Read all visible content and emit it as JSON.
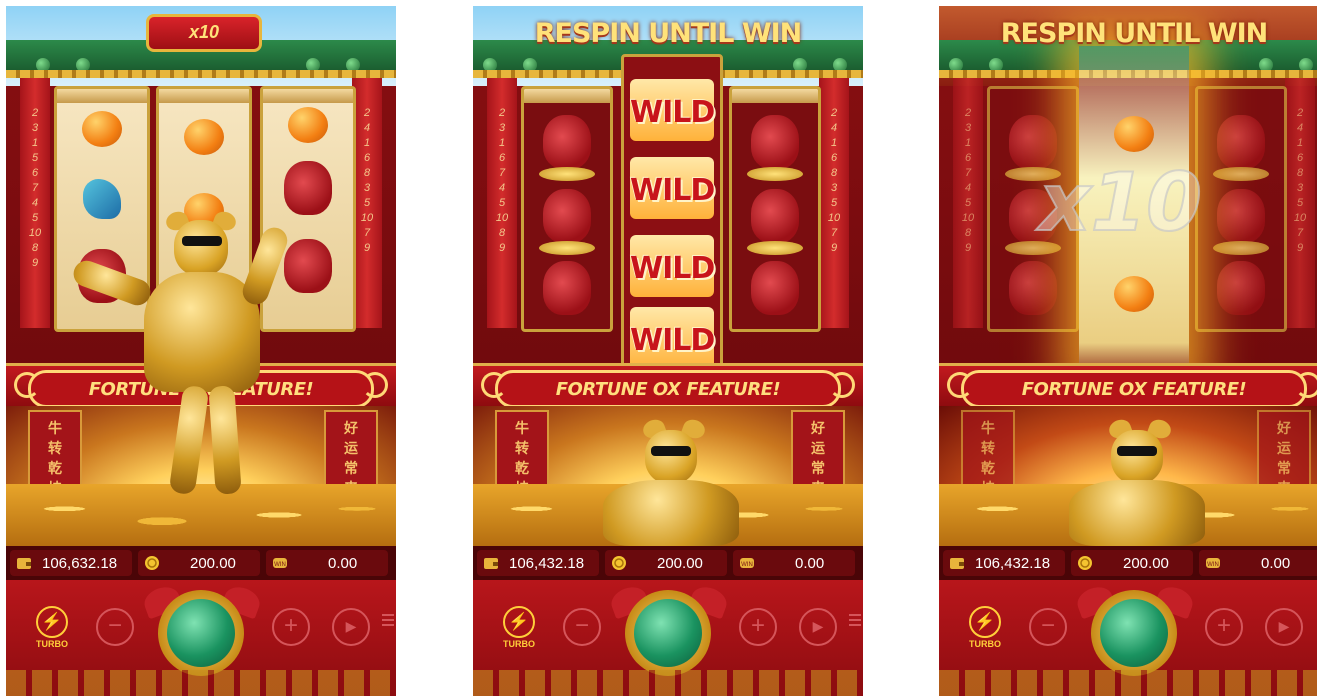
{
  "panels": [
    {
      "id": "panel-1",
      "has_top_banner": false,
      "top_badge": "x10",
      "pillar_numbers_left": [
        "2",
        "3",
        "1",
        "5",
        "6",
        "7",
        "4",
        "5",
        "10",
        "8",
        "9"
      ],
      "pillar_numbers_right": [
        "2",
        "4",
        "1",
        "6",
        "8",
        "3",
        "5",
        "10",
        "7",
        "9"
      ],
      "feature_text": "FORTUNE OX FEATURE!",
      "balance": "106,632.18",
      "bet": "200.00",
      "win": "0.00"
    },
    {
      "id": "panel-2",
      "top_banner": "RESPIN UNTIL WIN",
      "wild_labels": [
        "WILD",
        "WILD",
        "WILD",
        "WILD"
      ],
      "pillar_numbers_left": [
        "2",
        "3",
        "1",
        "6",
        "7",
        "4",
        "5",
        "10",
        "8",
        "9"
      ],
      "pillar_numbers_right": [
        "2",
        "4",
        "1",
        "6",
        "8",
        "3",
        "5",
        "10",
        "7",
        "9"
      ],
      "feature_text": "FORTUNE OX FEATURE!",
      "balance": "106,432.18",
      "bet": "200.00",
      "win": "0.00"
    },
    {
      "id": "panel-3",
      "top_banner": "RESPIN UNTIL WIN",
      "multiplier_text": "x10",
      "pillar_numbers_left": [
        "2",
        "3",
        "1",
        "6",
        "7",
        "4",
        "5",
        "10",
        "8",
        "9"
      ],
      "pillar_numbers_right": [
        "2",
        "4",
        "1",
        "6",
        "8",
        "3",
        "5",
        "10",
        "7",
        "9"
      ],
      "feature_text": "FORTUNE OX FEATURE!",
      "balance": "106,432.18",
      "bet": "200.00",
      "win": "0.00"
    }
  ],
  "banner_chars_left": [
    "牛",
    "转",
    "乾",
    "坤"
  ],
  "banner_chars_right": [
    "好",
    "运",
    "常",
    "来"
  ],
  "controls": {
    "turbo_label": "TURBO",
    "turbo_icon": "lightning-icon",
    "minus_icon": "minus-icon",
    "plus_icon": "plus-icon",
    "auto_icon": "play-icon",
    "menu_icon": "menu-icon",
    "spin_icon": "spin-icon"
  },
  "stat_icons": [
    "wallet-icon",
    "coin-icon",
    "win-icon"
  ],
  "colors": {
    "primary_red": "#b8161b",
    "gold": "#ffd977",
    "spin_green": "#1a9360",
    "wild_red": "#c8141b"
  }
}
